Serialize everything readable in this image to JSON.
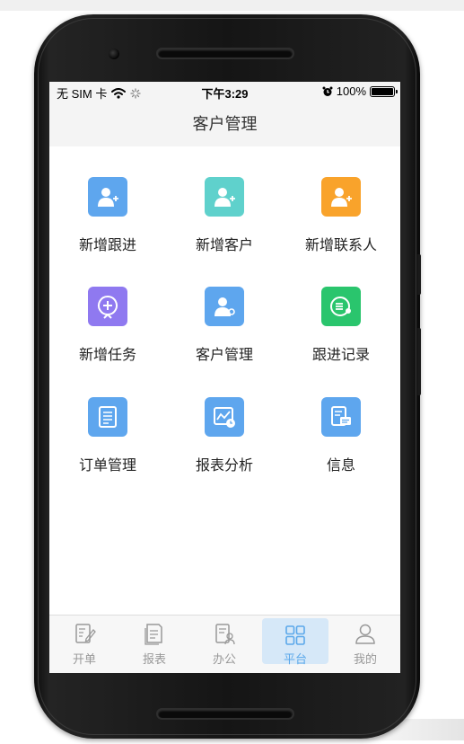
{
  "status_bar": {
    "carrier": "无 SIM 卡",
    "time": "下午3:29",
    "battery": "100%"
  },
  "nav": {
    "title": "客户管理"
  },
  "grid": [
    {
      "label": "新增跟进",
      "color": "#5ea6ee",
      "icon": "user-add-icon"
    },
    {
      "label": "新增客户",
      "color": "#5fd1cc",
      "icon": "user-add-icon"
    },
    {
      "label": "新增联系人",
      "color": "#f9a32b",
      "icon": "user-add-icon"
    },
    {
      "label": "新增任务",
      "color": "#8f79f0",
      "icon": "task-add-icon"
    },
    {
      "label": "客户管理",
      "color": "#5ea6ee",
      "icon": "user-settings-icon"
    },
    {
      "label": "跟进记录",
      "color": "#2ac56d",
      "icon": "record-icon"
    },
    {
      "label": "订单管理",
      "color": "#5ea6ee",
      "icon": "document-icon"
    },
    {
      "label": "报表分析",
      "color": "#5ea6ee",
      "icon": "chart-clock-icon"
    },
    {
      "label": "信息",
      "color": "#5ea6ee",
      "icon": "message-icon"
    }
  ],
  "tabs": [
    {
      "label": "开单",
      "icon": "edit-doc-icon",
      "active": false
    },
    {
      "label": "报表",
      "icon": "report-icon",
      "active": false
    },
    {
      "label": "办公",
      "icon": "office-icon",
      "active": false
    },
    {
      "label": "平台",
      "icon": "grid-icon",
      "active": true
    },
    {
      "label": "我的",
      "icon": "person-icon",
      "active": false
    }
  ]
}
